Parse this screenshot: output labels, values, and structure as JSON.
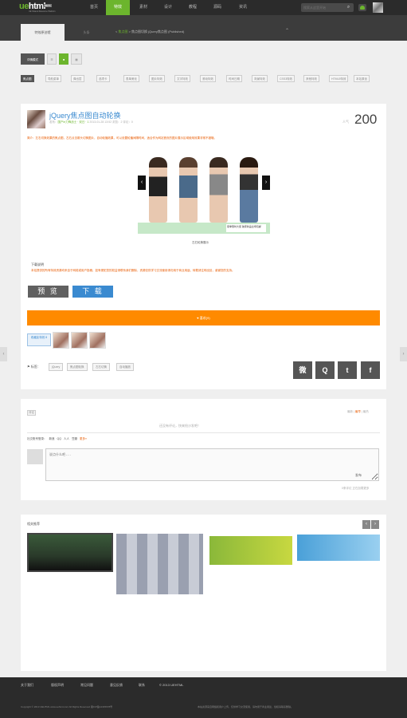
{
  "brand": {
    "logo_prefix": "ue",
    "logo_rest": "html",
    "badge": "BETA",
    "tagline": "UE Shared Resource Platform"
  },
  "nav": [
    "首页",
    "特效",
    "素材",
    "设计",
    "教程",
    "源码",
    "资讯"
  ],
  "search": {
    "placeholder": "搜索从这里开始"
  },
  "subtabs": [
    "特效原创馆",
    "头条"
  ],
  "breadcrumb": {
    "sep": "<",
    "cur": "焦点图",
    "rest": "> 焦点图切换 jQuery焦点图",
    "extra": "(Published)"
  },
  "view_buttons": [
    "详情模式"
  ],
  "filters": [
    "焦点图",
    "导航菜单",
    "弹出层",
    "选项卡",
    "表单美化",
    "图片特效",
    "文字特效",
    "滚动特效",
    "时间日期",
    "背景特效",
    "CSS3特效",
    "其他特效",
    "HTML5特效",
    "本站原创"
  ],
  "article": {
    "title": "jQuery焦点图自动轮换",
    "meta_pre": "发布：",
    "meta_author": "国产ie刀锋战士 · 双日 · 1",
    "meta_post": " 2013-01-28 13:52  浏览：2  评论：0",
    "views_label": "人气",
    "views": "200",
    "intro": "简介：左右切换效果的焦点图，左右点击箭头切换图片，自动轮播效果，可以设置轮播间隔时间，适合作为网站首页的图片展示区域使用效果非常不错哦。",
    "slide_caption": "夏季限时大促 独家新品全场包邮",
    "pager": "左右轮换展示",
    "notice_title": "下载说明",
    "notice_text": "本站提供的所有特效资源均来自于网络或用户投稿，如有侵犯您的权益请联系我们删除，资源仅供学习交流使用请勿用于商业用途，转载请注明出处，谢谢您的支持。",
    "btn_preview": "预 览",
    "btn_download": "下 载",
    "like": "喜欢(9)",
    "fav_first": "收藏此特效 8"
  },
  "tags": {
    "label": "标签：",
    "items": [
      "jQuery",
      "焦点图轮换",
      "左右切换",
      "自动播放"
    ]
  },
  "share": [
    "微",
    "Q",
    "t",
    "f"
  ],
  "comments": {
    "label": "评论",
    "sort_pre": "最新 | ",
    "sort_on": "最早",
    "sort_post": " | 最热",
    "empty": "还没有评论，快来抢沙发吧！",
    "login_label": "社交账号登录：",
    "login_items": [
      "新浪",
      "QQ",
      "人人",
      "豆瓣",
      "更多»"
    ],
    "placeholder": "说点什么吧...",
    "submit": "发布",
    "stat": "0条评论 正在加载更多"
  },
  "related": {
    "title": "相关推荐",
    "prev": "‹",
    "next": "›"
  },
  "footer": {
    "links": [
      "关于我们",
      "版权声明",
      "常见问题",
      "意见反馈",
      "联系",
      "© 2013 UEHTML"
    ],
    "copy_left": "Copyright © 2013 UEHTML www.uehtml.com All Rights Reserved 湘ICP备12345678号",
    "copy_right": "本站资源来自网络和用户上传，仅供学习交流使用，请勿用于商业用途，侵权请联系删除。"
  }
}
